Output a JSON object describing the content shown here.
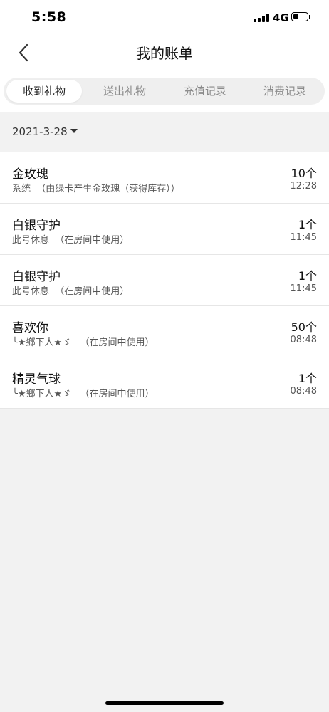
{
  "status_bar": {
    "time": "5:58",
    "network": "4G"
  },
  "nav": {
    "title": "我的账单",
    "back_icon": "chevron-left-icon"
  },
  "tabs": [
    {
      "label": "收到礼物",
      "active": true
    },
    {
      "label": "送出礼物",
      "active": false
    },
    {
      "label": "充值记录",
      "active": false
    },
    {
      "label": "消费记录",
      "active": false
    }
  ],
  "date_filter": {
    "value": "2021-3-28",
    "icon": "caret-down-icon"
  },
  "records": [
    {
      "name": "金玫瑰",
      "sub": "系统  （由绿卡产生金玫瑰（获得库存））",
      "count": "10个",
      "time": "12:28"
    },
    {
      "name": "白银守护",
      "sub": "此号休息  （在房间中使用）",
      "count": "1个",
      "time": "11:45"
    },
    {
      "name": "白银守护",
      "sub": "此号休息  （在房间中使用）",
      "count": "1个",
      "time": "11:45"
    },
    {
      "name": "喜欢你",
      "sub": "╰★鄉下人★ゞ   （在房间中使用）",
      "count": "50个",
      "time": "08:48"
    },
    {
      "name": "精灵气球",
      "sub": "╰★鄉下人★ゞ   （在房间中使用）",
      "count": "1个",
      "time": "08:48"
    }
  ],
  "colors": {
    "background": "#f2f2f2",
    "surface": "#ffffff",
    "tab_track": "#efefef",
    "text_primary": "#111111",
    "text_secondary": "#555555",
    "tab_inactive": "#8a8a8a"
  }
}
